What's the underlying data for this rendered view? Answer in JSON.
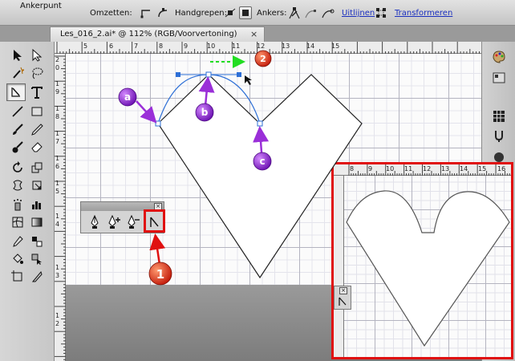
{
  "control_bar": {
    "context_label": "Ankerpunt",
    "convert_label": "Omzetten:",
    "handles_label": "Handgrepen:",
    "anchors_label": "Ankers:",
    "align_link": "Uitlijnen",
    "transform_link": "Transformeren"
  },
  "document_tab": {
    "title": "Les_016_2.ai* @ 112% (RGB/Voorvertoning)",
    "close": "×"
  },
  "horizontal_ruler": {
    "labels": [
      "5",
      "6",
      "7",
      "8",
      "9",
      "10",
      "11",
      "12",
      "13",
      "14",
      "15"
    ]
  },
  "vertical_ruler": {
    "labels": [
      "2",
      "0",
      "1",
      "9",
      "1",
      "8",
      "1",
      "7",
      "1",
      "6",
      "1",
      "5",
      "1",
      "4",
      "1",
      "3",
      "1",
      "2"
    ]
  },
  "inset_ruler": {
    "labels": [
      "8",
      "9",
      "10",
      "11",
      "12",
      "13",
      "14",
      "15",
      "16"
    ]
  },
  "anchor_panel": {
    "close": "×"
  },
  "inset_panel": {
    "close": "×"
  },
  "annotations": {
    "a": "a",
    "b": "b",
    "c": "c",
    "step1": "1",
    "step2": "2"
  },
  "colors": {
    "annotation_purple": "#9a2fd8",
    "step_badge_red": "#e03020",
    "highlight_red": "#e01010",
    "drag_arrow_green": "#22dd22",
    "path_blue": "#2d6fd6",
    "link_blue": "#1a2fbf"
  },
  "icons": {
    "tools": [
      "selection-tool-icon",
      "direct-selection-tool-icon",
      "magic-wand-tool-icon",
      "lasso-tool-icon",
      "pen-tool-icon",
      "type-tool-icon",
      "line-segment-tool-icon",
      "rectangle-tool-icon",
      "paintbrush-tool-icon",
      "pencil-tool-icon",
      "blob-brush-tool-icon",
      "eraser-tool-icon",
      "rotate-tool-icon",
      "scale-tool-icon",
      "warp-tool-icon",
      "free-transform-tool-icon",
      "symbol-sprayer-tool-icon",
      "column-graph-tool-icon",
      "mesh-tool-icon",
      "gradient-tool-icon",
      "eyedropper-tool-icon",
      "blend-tool-icon",
      "live-paint-bucket-tool-icon",
      "live-paint-selection-tool-icon",
      "artboard-tool-icon",
      "slice-tool-icon"
    ],
    "panel": [
      "add-anchor-point-icon",
      "add-anchor-plus-icon",
      "delete-anchor-point-icon",
      "convert-anchor-point-icon"
    ],
    "dock": [
      "color-palette-icon",
      "swatches-icon",
      "brushes-icon",
      "symbols-icon"
    ]
  }
}
